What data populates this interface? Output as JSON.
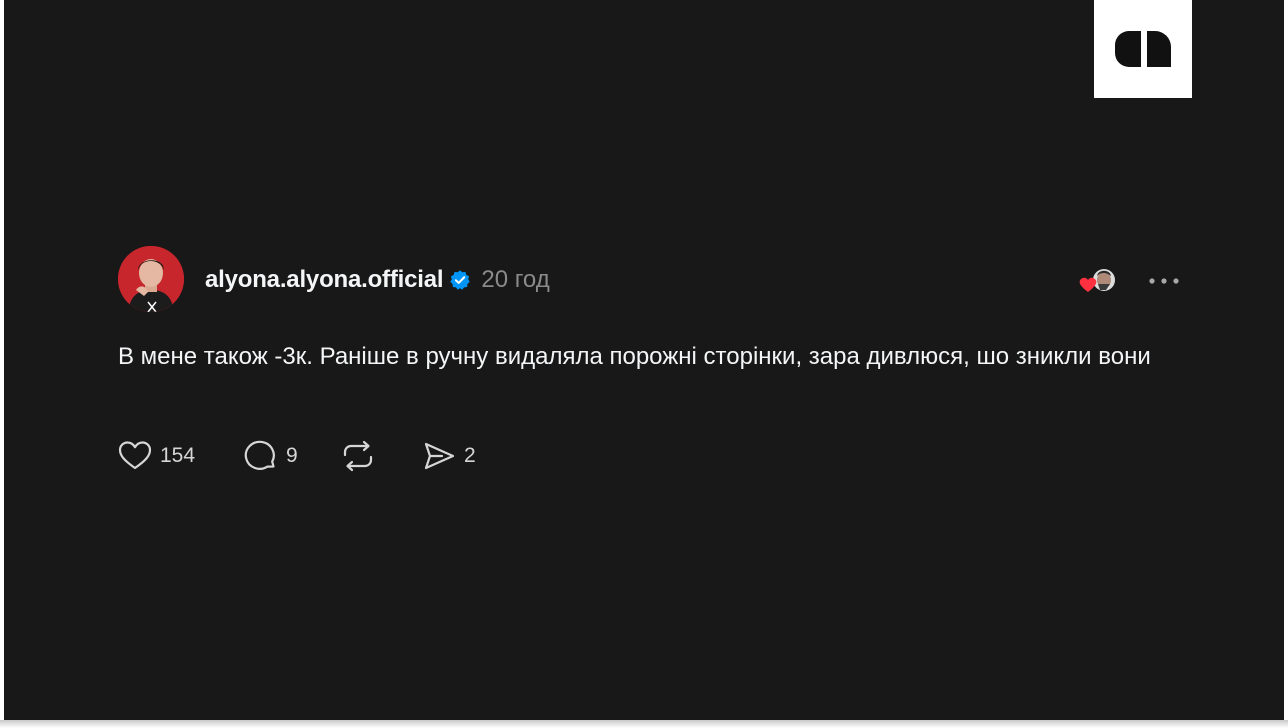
{
  "post": {
    "username": "alyona.alyona.official",
    "time": "20 год",
    "text": "В мене також -3к. Раніше в ручну видаляла порожні сторінки, зара дивлюся, шо зникли вони",
    "verified_color": "#0095f6",
    "actions": {
      "likes": "154",
      "comments": "9",
      "shares": "2"
    }
  },
  "icons": {
    "logo": "brand-logo-icon",
    "verified": "verified-badge-icon",
    "liked_by": "liked-by-avatar-heart-icon",
    "more": "more-dots-icon",
    "like": "heart-icon",
    "comment": "comment-bubble-icon",
    "repost": "repost-icon",
    "share": "share-send-icon"
  },
  "colors": {
    "background": "#181818",
    "text": "#f3f5f7",
    "muted": "#8a8a8a",
    "heart": "#ff3040"
  }
}
